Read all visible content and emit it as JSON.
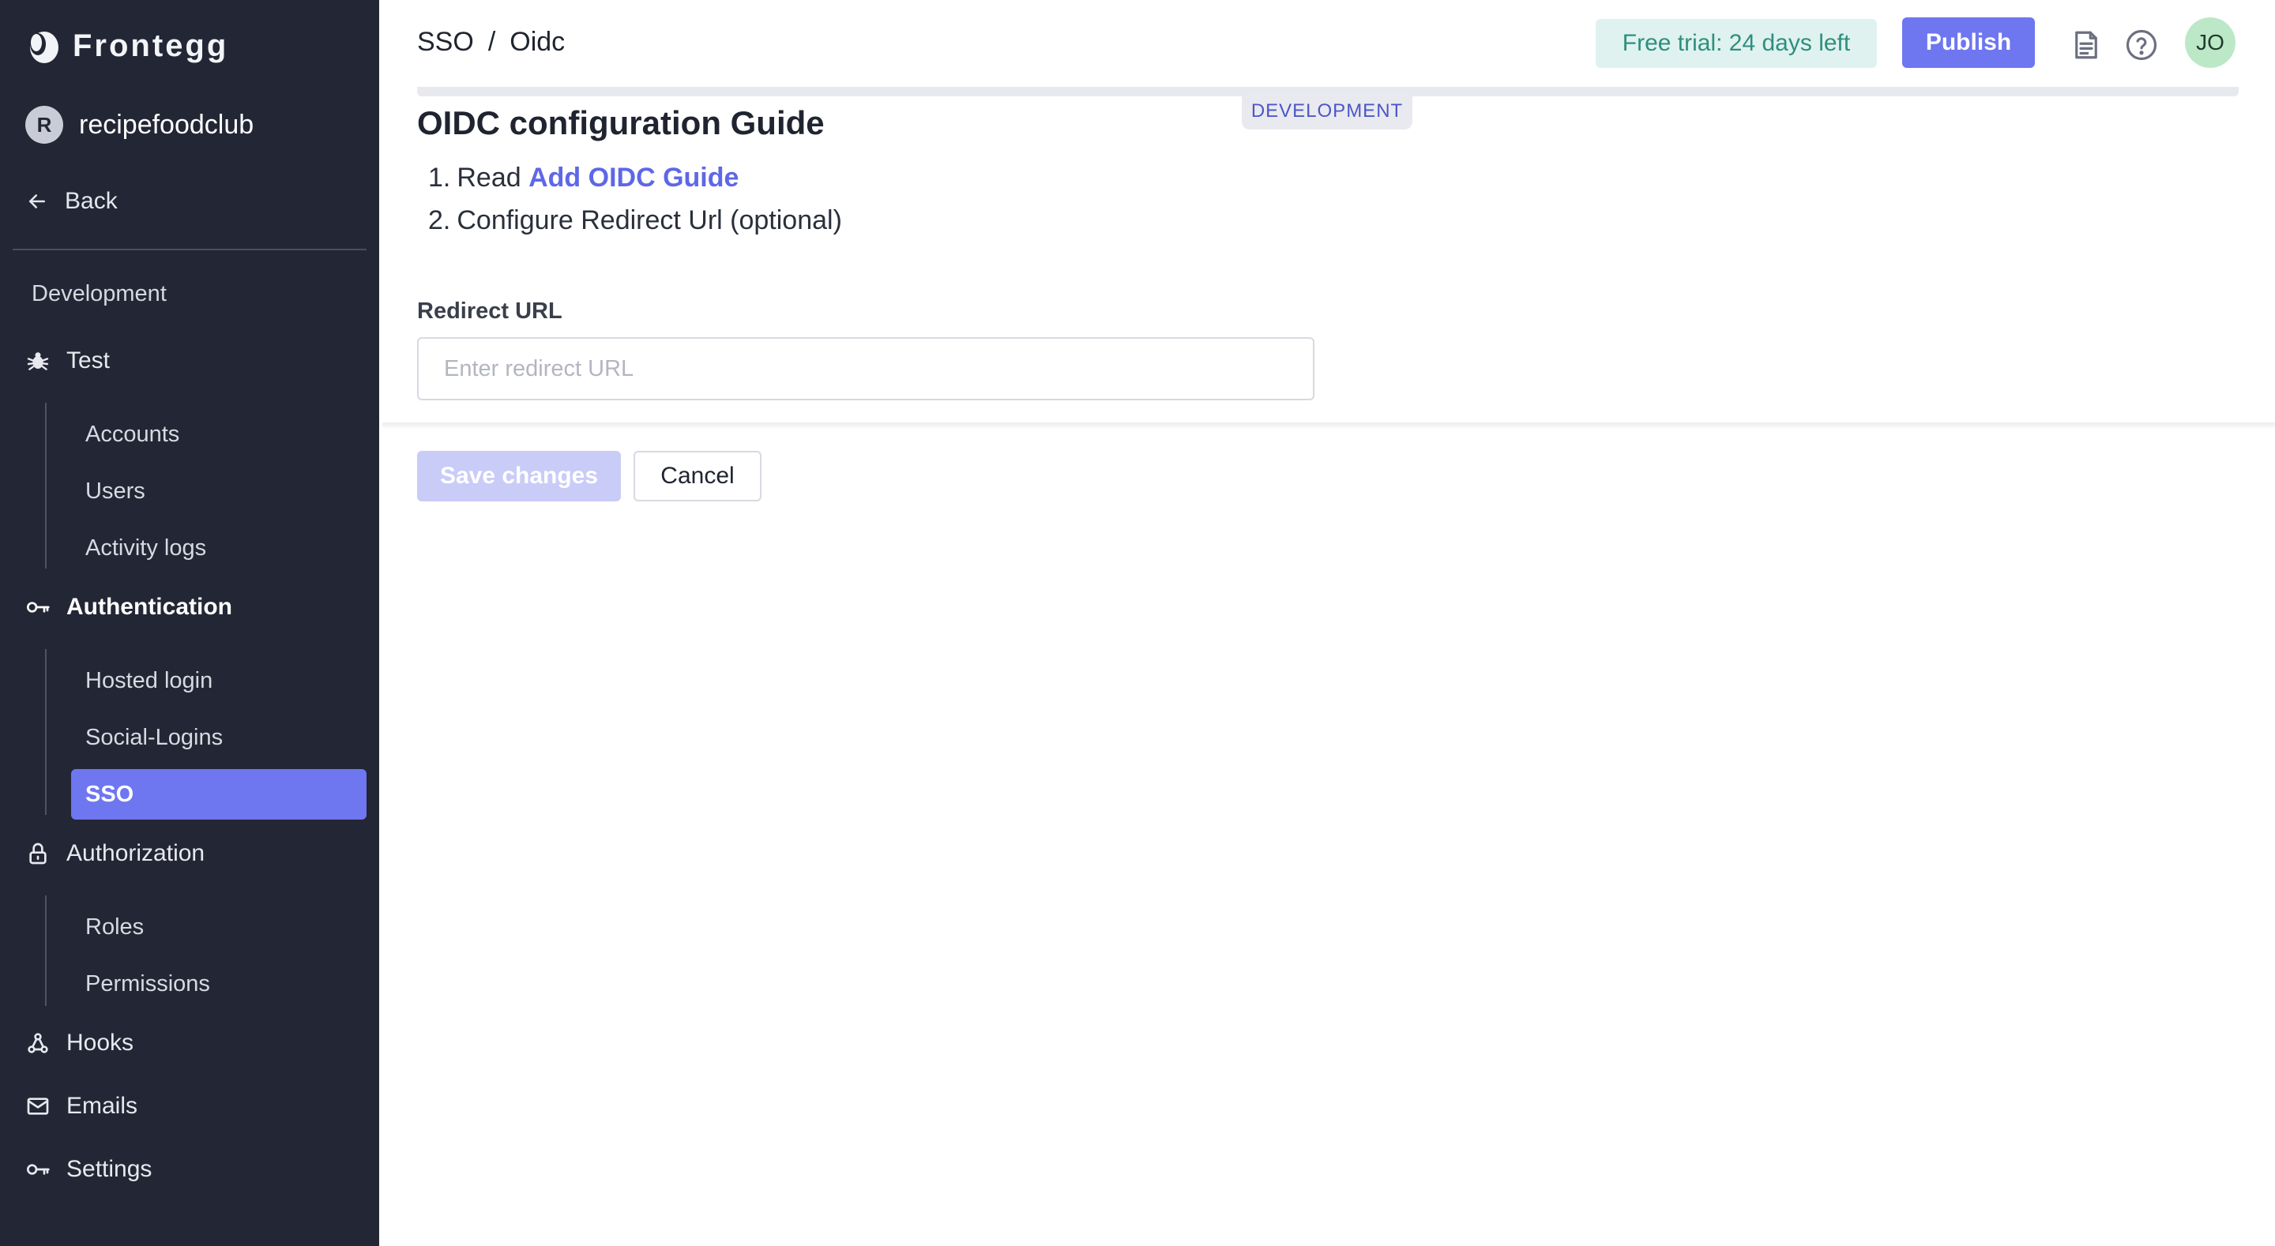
{
  "app": {
    "brand_name": "Frontegg",
    "workspace_initial": "R",
    "workspace_name": "recipefoodclub"
  },
  "sidebar": {
    "back_label": "Back",
    "section_label": "Development",
    "test": {
      "label": "Test",
      "items": [
        {
          "label": "Accounts"
        },
        {
          "label": "Users"
        },
        {
          "label": "Activity logs"
        }
      ]
    },
    "authentication": {
      "label": "Authentication",
      "items": [
        {
          "label": "Hosted login"
        },
        {
          "label": "Social-Logins"
        },
        {
          "label": "SSO",
          "active": true
        }
      ]
    },
    "authorization": {
      "label": "Authorization",
      "items": [
        {
          "label": "Roles"
        },
        {
          "label": "Permissions"
        }
      ]
    },
    "hooks_label": "Hooks",
    "emails_label": "Emails",
    "settings_label": "Settings"
  },
  "header": {
    "breadcrumb": [
      "SSO",
      "/",
      "Oidc"
    ],
    "trial_badge": "Free trial: 24 days left",
    "publish_label": "Publish",
    "user_initials": "JO",
    "env_badge": "DEVELOPMENT"
  },
  "main": {
    "guide_title": "OIDC configuration Guide",
    "step1_num": "1.",
    "step1_prefix": "Read",
    "step1_link": "Add OIDC Guide",
    "step2_num": "2.",
    "step2_text": "Configure Redirect Url (optional)",
    "redirect_label": "Redirect URL",
    "redirect_value": "",
    "redirect_placeholder": "Enter redirect URL",
    "save_label": "Save changes",
    "cancel_label": "Cancel"
  },
  "colors": {
    "sidebar_bg": "#232634",
    "accent": "#6e76f0",
    "trial_bg": "#dff2ef",
    "trial_text": "#2f8f7e",
    "link": "#5e67e8"
  }
}
